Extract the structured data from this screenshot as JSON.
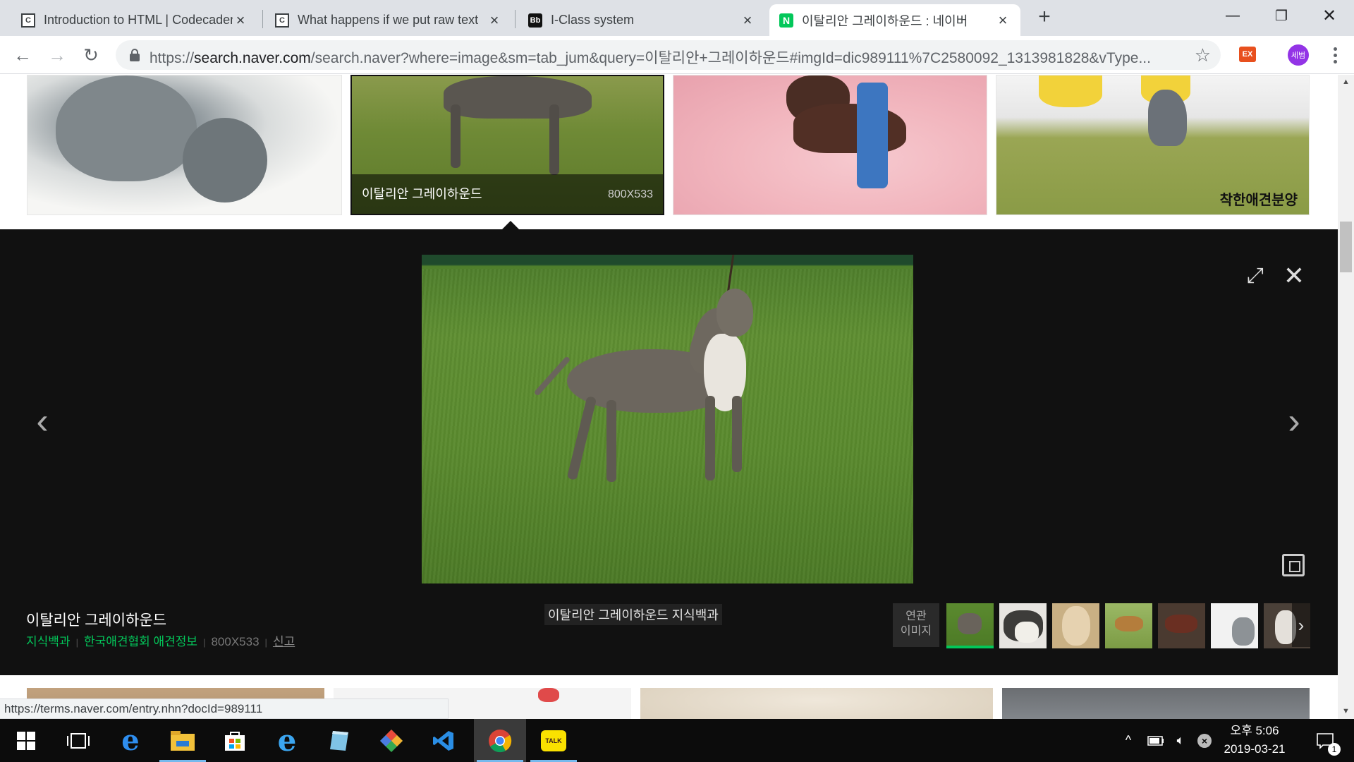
{
  "browser": {
    "tabs": [
      {
        "title": "Introduction to HTML | Codecademy",
        "favicon": "codecademy",
        "active": false
      },
      {
        "title": "What happens if we put raw text",
        "favicon": "codecademy",
        "active": false
      },
      {
        "title": "I-Class system",
        "favicon": "blackboard",
        "active": false
      },
      {
        "title": "이탈리안 그레이하운드 : 네이버",
        "favicon": "naver",
        "active": true
      }
    ],
    "url_scheme": "https://",
    "url_host": "search.naver.com",
    "url_path": "/search.naver?where=image&sm=tab_jum&query=이탈리안+그레이하운드#imgId=dic989111%7C2580092_1313981828&vType...",
    "ext_label": "EX",
    "profile_label": "세범"
  },
  "top_row": {
    "selected_caption": "이탈리안 그레이하운드",
    "selected_size": "800X533",
    "watermark": "착한애견분양"
  },
  "viewer": {
    "photo_caption": "이탈리안 그레이하운드 지식백과",
    "title": "이탈리안 그레이하운드",
    "source_1": "지식백과",
    "source_2": "한국애견협회 애견정보",
    "size": "800X533",
    "report": "신고",
    "related_label_1": "연관",
    "related_label_2": "이미지",
    "related_count": 7
  },
  "status_url": "https://terms.naver.com/entry.nhn?docId=989111",
  "taskbar": {
    "time": "오후 5:06",
    "date": "2019-03-21",
    "notification_count": "1",
    "kakao_label": "TALK"
  },
  "colors": {
    "naver_green": "#03c75a",
    "viewer_bg": "#111111",
    "taskbar_bg": "#0c0c0c"
  }
}
